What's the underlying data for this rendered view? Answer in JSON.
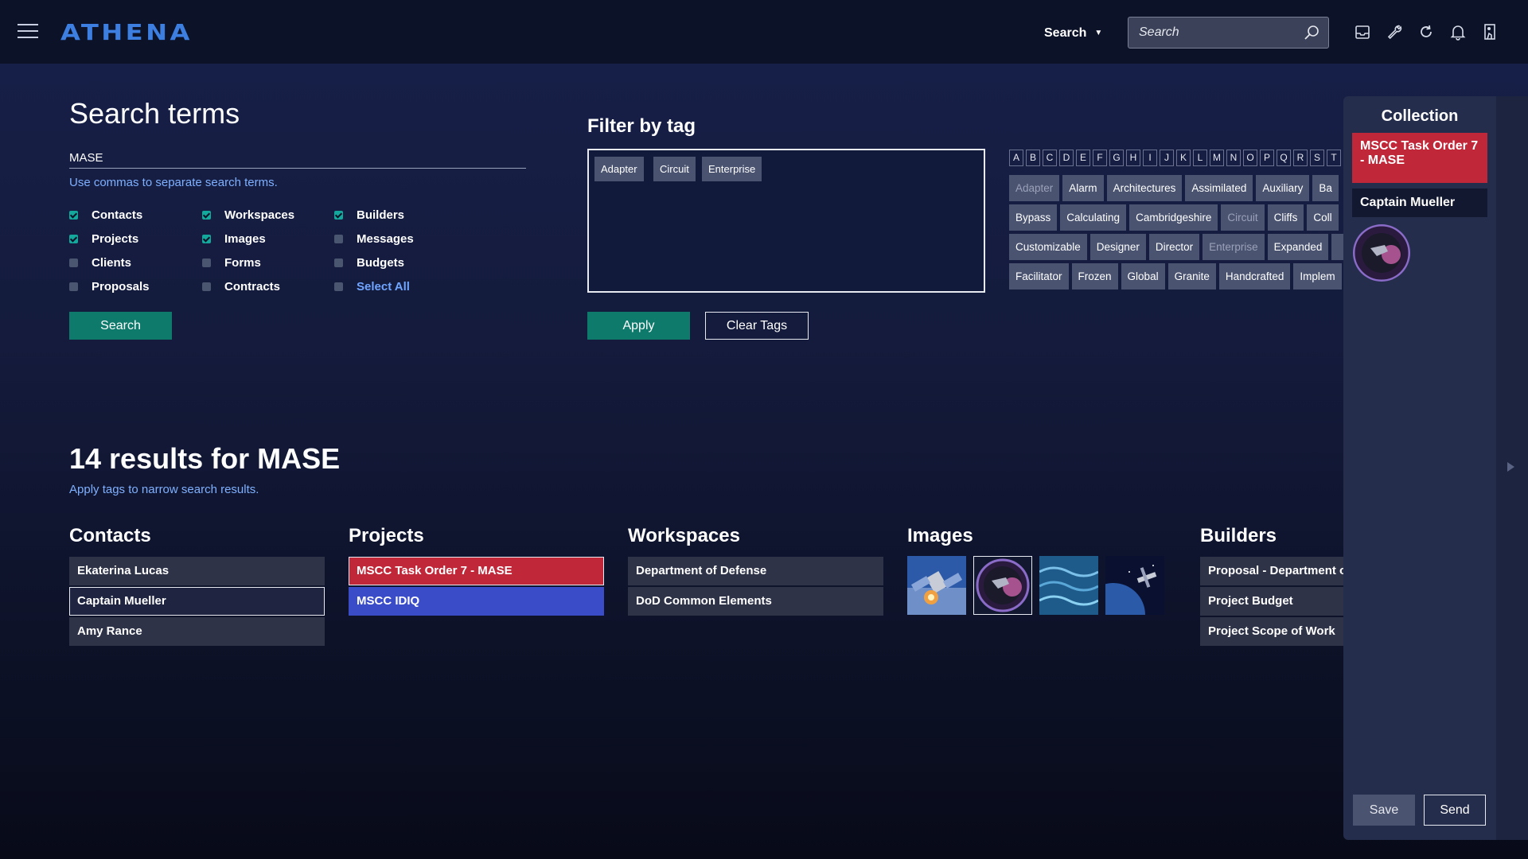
{
  "app": {
    "logo": "ATHENA"
  },
  "header": {
    "search_mode": "Search",
    "search_placeholder": "Search",
    "icons": [
      "inbox-icon",
      "wrench-icon",
      "refresh-icon",
      "bell-icon",
      "user-door-icon"
    ]
  },
  "search_terms": {
    "title": "Search terms",
    "value": "MASE",
    "hint": "Use commas to separate search terms.",
    "checkboxes": [
      {
        "label": "Contacts",
        "checked": true
      },
      {
        "label": "Projects",
        "checked": true
      },
      {
        "label": "Clients",
        "checked": false
      },
      {
        "label": "Proposals",
        "checked": false
      },
      {
        "label": "Workspaces",
        "checked": true
      },
      {
        "label": "Images",
        "checked": true
      },
      {
        "label": "Forms",
        "checked": false
      },
      {
        "label": "Contracts",
        "checked": false
      },
      {
        "label": "Builders",
        "checked": true
      },
      {
        "label": "Messages",
        "checked": false
      },
      {
        "label": "Budgets",
        "checked": false
      },
      {
        "label": "Select All",
        "checked": false
      }
    ],
    "search_button": "Search"
  },
  "filter": {
    "title": "Filter by tag",
    "selected_tags": [
      "Adapter",
      "Circuit",
      "Enterprise"
    ],
    "apply_button": "Apply",
    "clear_button": "Clear Tags",
    "letters": [
      "A",
      "B",
      "C",
      "D",
      "E",
      "F",
      "G",
      "H",
      "I",
      "J",
      "K",
      "L",
      "M",
      "N",
      "O",
      "P",
      "Q",
      "R",
      "S",
      "T"
    ],
    "tag_rows": [
      [
        "Adapter",
        "Alarm",
        "Architectures",
        "Assimilated",
        "Auxiliary",
        "Ba"
      ],
      [
        "Bypass",
        "Calculating",
        "Cambridgeshire",
        "Circuit",
        "Cliffs",
        "Coll"
      ],
      [
        "Customizable",
        "Designer",
        "Director",
        "Enterprise",
        "Expanded",
        ""
      ],
      [
        "Facilitator",
        "Frozen",
        "Global",
        "Granite",
        "Handcrafted",
        "Implem"
      ]
    ],
    "used_tags": [
      "Adapter",
      "Circuit",
      "Enterprise"
    ]
  },
  "results": {
    "title": "14 results for MASE",
    "hint": "Apply tags to narrow search results.",
    "contacts": {
      "title": "Contacts",
      "items": [
        "Ekaterina Lucas",
        "Captain Mueller",
        "Amy Rance"
      ]
    },
    "projects": {
      "title": "Projects",
      "items": [
        "MSCC Task Order 7 - MASE",
        "MSCC IDIQ"
      ]
    },
    "workspaces": {
      "title": "Workspaces",
      "items": [
        "Department of Defense",
        "DoD Common Elements"
      ]
    },
    "images": {
      "title": "Images",
      "items": [
        "satellite-image",
        "mission-patch-image",
        "blue-waves-image",
        "space-station-image"
      ]
    },
    "builders": {
      "title": "Builders",
      "items": [
        "Proposal - Department of",
        "Project Budget",
        "Project Scope of Work"
      ]
    }
  },
  "collection": {
    "title": "Collection",
    "items": [
      "MSCC Task Order 7 - MASE",
      "Captain Mueller"
    ],
    "save_button": "Save",
    "send_button": "Send"
  }
}
